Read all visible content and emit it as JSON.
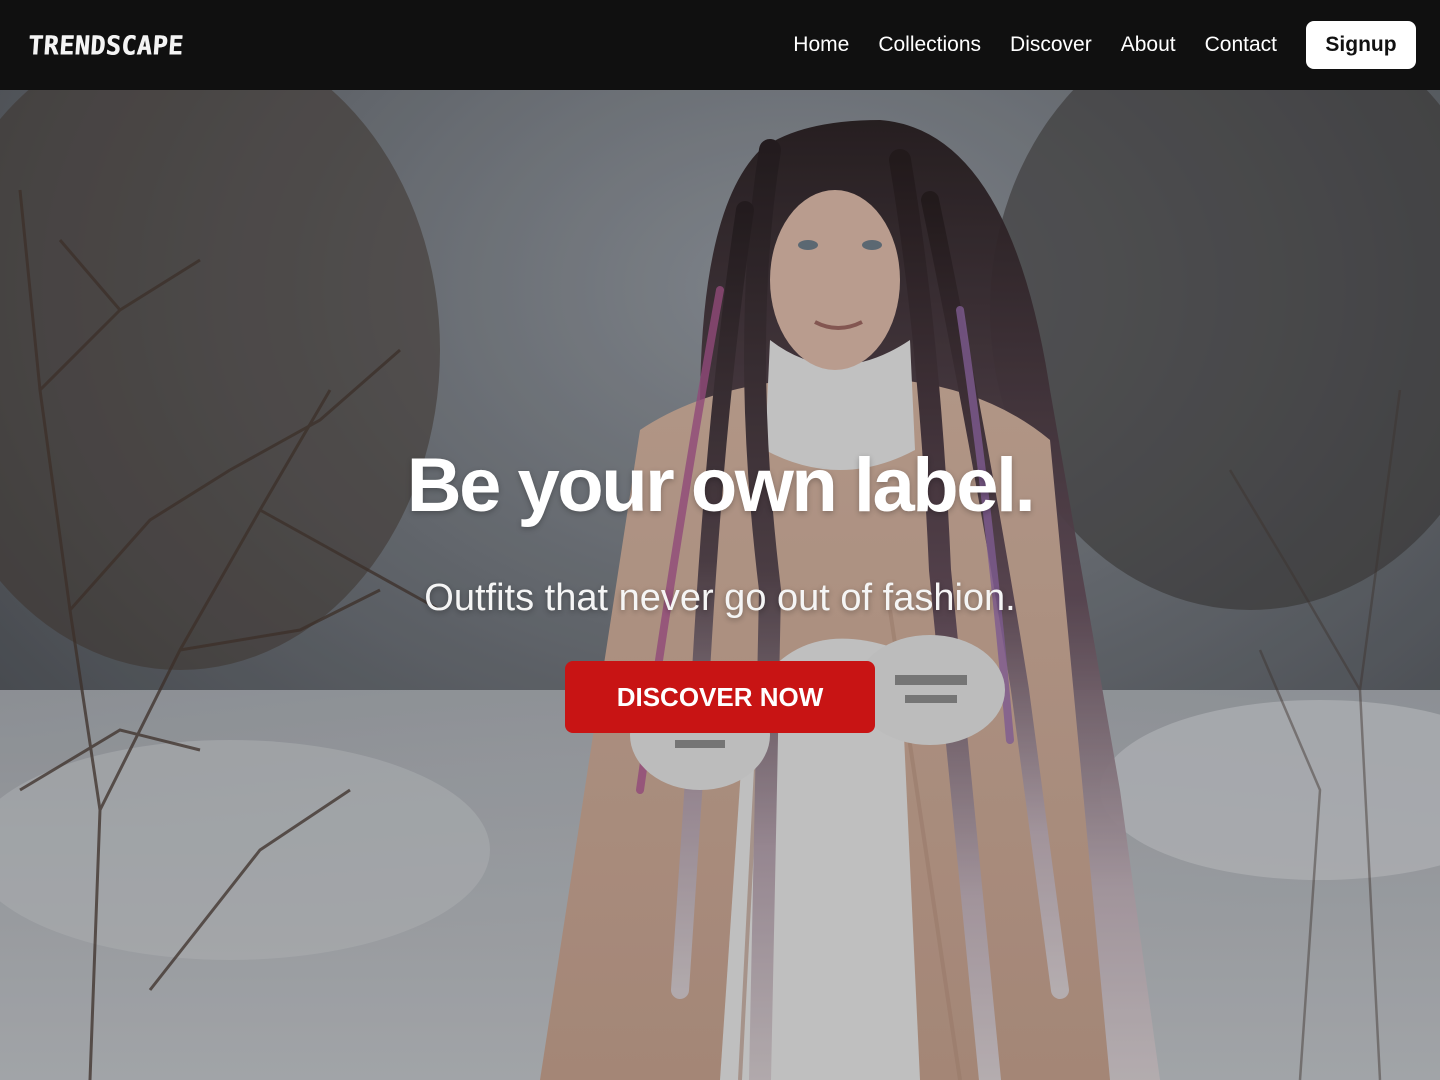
{
  "brand": {
    "logo_text": "TRENDSCAPE"
  },
  "nav": {
    "links": [
      {
        "label": "Home"
      },
      {
        "label": "Collections"
      },
      {
        "label": "Discover"
      },
      {
        "label": "About"
      },
      {
        "label": "Contact"
      }
    ],
    "signup_label": "Signup"
  },
  "hero": {
    "title": "Be your own label.",
    "subtitle": "Outfits that never go out of fashion.",
    "cta_label": "DISCOVER NOW",
    "background_image": "woman-with-long-dreadlocks-wrapped-in-beige-blanket-winter-forest"
  },
  "colors": {
    "nav_background": "#101010",
    "cta_red": "#c81414",
    "signup_background": "#ffffff"
  }
}
